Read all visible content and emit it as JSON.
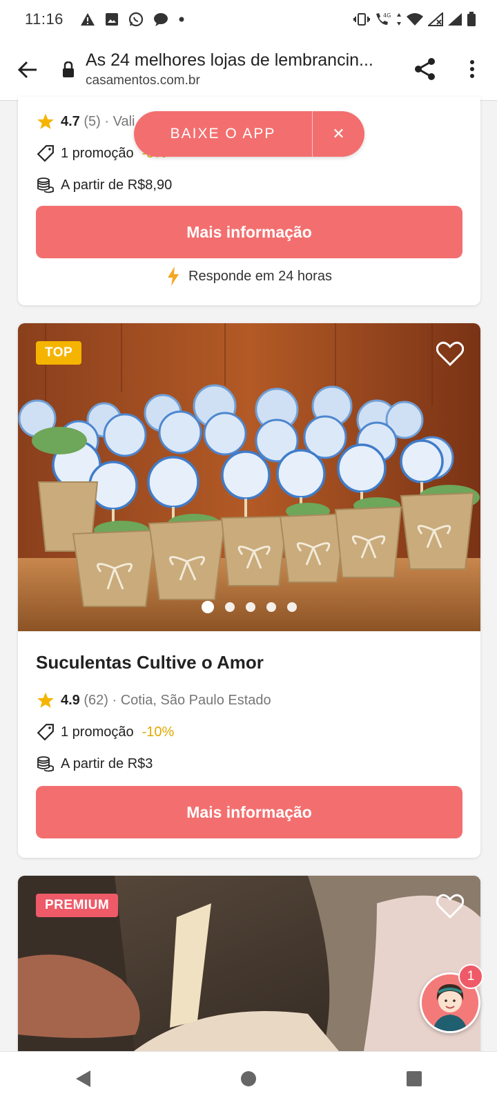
{
  "status_bar": {
    "time": "11:16",
    "left_icons": [
      "alert-icon",
      "image-icon",
      "whatsapp-icon",
      "chat-bubble-icon",
      "dot-icon"
    ],
    "right_icons": [
      "vibrate-icon",
      "call-4g-icon",
      "wifi-icon",
      "signal-x-icon",
      "signal-icon",
      "battery-icon"
    ],
    "network_label": "4G"
  },
  "browser": {
    "title": "As 24 melhores lojas de lembrancin...",
    "domain": "casamentos.com.br"
  },
  "app_banner": {
    "label": "BAIXE O APP",
    "close": "✕"
  },
  "cards": [
    {
      "rating": "4.7",
      "reviews": "(5)",
      "location": "· Vali",
      "promo": "1 promoção",
      "discount": "-5%",
      "price": "A partir de R$8,90",
      "cta": "Mais informação",
      "response": "Responde em 24 horas"
    },
    {
      "badge": "TOP",
      "name": "Suculentas Cultive o Amor",
      "rating": "4.9",
      "reviews": "(62)",
      "location": "· Cotia, São Paulo Estado",
      "promo": "1 promoção",
      "discount": "-10%",
      "price": "A partir de R$3",
      "cta": "Mais informação",
      "gallery_dots": 5,
      "gallery_active": 0
    },
    {
      "badge": "PREMIUM"
    }
  ],
  "chat": {
    "badge_count": "1"
  },
  "colors": {
    "accent": "#f36f6f",
    "top_badge": "#f5b400",
    "premium_badge": "#ee5a68",
    "star": "#f5b400",
    "discount": "#e0a800"
  }
}
